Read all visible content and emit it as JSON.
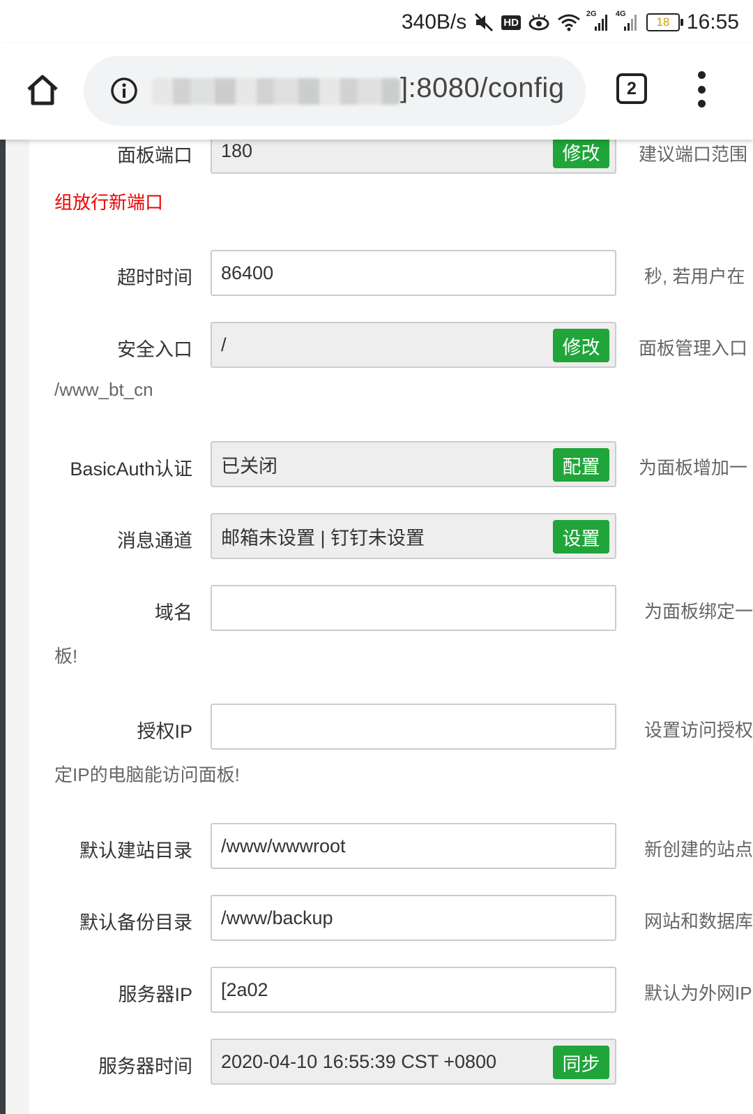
{
  "status_bar": {
    "speed": "340B/s",
    "hd": "HD",
    "sig1_tag": "2G",
    "sig2_tag": "4G",
    "battery": "18",
    "time": "16:55"
  },
  "browser": {
    "url_visible": "]:8080/config",
    "tab_count": "2"
  },
  "form": [
    {
      "id": "panel-port",
      "label": "面板端口",
      "value": "180",
      "disabled": true,
      "button": "修改",
      "desc": "建议端口范围",
      "continuation": "组放行新端口",
      "continuation_red": true
    },
    {
      "id": "timeout",
      "label": "超时时间",
      "value": "86400",
      "disabled": false,
      "desc": "秒, 若用户在"
    },
    {
      "id": "security-entry",
      "label": "安全入口",
      "value": "/",
      "disabled": true,
      "button": "修改",
      "desc": "面板管理入口",
      "continuation": "/www_bt_cn"
    },
    {
      "id": "basicauth",
      "label": "BasicAuth认证",
      "value": "已关闭",
      "disabled": true,
      "button": "配置",
      "desc": "为面板增加一"
    },
    {
      "id": "message-channel",
      "label": "消息通道",
      "value": "邮箱未设置 | 钉钉未设置",
      "disabled": true,
      "button": "设置",
      "desc": ""
    },
    {
      "id": "domain",
      "label": "域名",
      "value": "",
      "disabled": false,
      "desc": "为面板绑定一",
      "continuation": "板!"
    },
    {
      "id": "auth-ip",
      "label": "授权IP",
      "value": "",
      "disabled": false,
      "desc": "设置访问授权",
      "continuation": "定IP的电脑能访问面板!"
    },
    {
      "id": "site-dir",
      "label": "默认建站目录",
      "value": "/www/wwwroot",
      "disabled": false,
      "desc": "新创建的站点"
    },
    {
      "id": "backup-dir",
      "label": "默认备份目录",
      "value": "/www/backup",
      "disabled": false,
      "desc": "网站和数据库"
    },
    {
      "id": "server-ip",
      "label": "服务器IP",
      "value": "[2a02",
      "disabled": false,
      "desc": "默认为外网IP"
    },
    {
      "id": "server-time",
      "label": "服务器时间",
      "value": "2020-04-10 16:55:39 CST +0800",
      "disabled": true,
      "button": "同步",
      "desc": ""
    }
  ],
  "colors": {
    "accent_green": "#20a53a",
    "warning_red": "#ee0000"
  }
}
